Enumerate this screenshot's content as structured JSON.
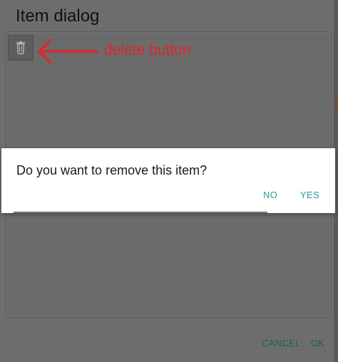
{
  "item_dialog": {
    "title": "Item dialog",
    "cancel_label": "CANCEL",
    "ok_label": "OK",
    "delete_icon": "trash-can-icon"
  },
  "annotation": {
    "text": "delete button",
    "color": "#e0262b"
  },
  "confirm_dialog": {
    "message": "Do you want to remove this item?",
    "no_label": "NO",
    "yes_label": "YES",
    "accent_color": "#2a9c95"
  }
}
